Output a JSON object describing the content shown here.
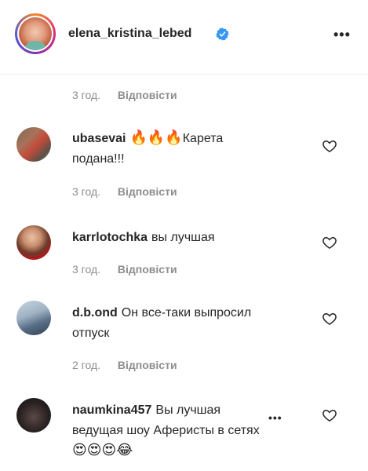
{
  "post": {
    "username": "elena_kristina_lebed",
    "verified": true,
    "more_icon": "more-horizontal-icon"
  },
  "first_meta": {
    "time": "3 год.",
    "reply": "Відповісти"
  },
  "comments": [
    {
      "username": "ubasevai",
      "emoji": "🔥🔥🔥",
      "text_line1": "Карета",
      "text_line2": "подана!!!",
      "time": "3 год.",
      "reply": "Відповісти"
    },
    {
      "username": "karrlotochka",
      "text": "вы лучшая",
      "time": "3 год.",
      "reply": "Відповісти"
    },
    {
      "username": "d.b.ond",
      "text_line1": "Он все-таки выпросил",
      "text_line2": "отпуск",
      "time": "2 год.",
      "reply": "Відповісти"
    },
    {
      "username": "naumkina457",
      "text_line1": "Вы лучшая",
      "text_line2": "ведущая шоу Аферисты в сетях",
      "emoji_line": "😍😍😍😂"
    }
  ],
  "colors": {
    "text": "#262626",
    "secondary": "#8e8e8e",
    "verified": "#3897f0",
    "divider": "#efefef"
  }
}
